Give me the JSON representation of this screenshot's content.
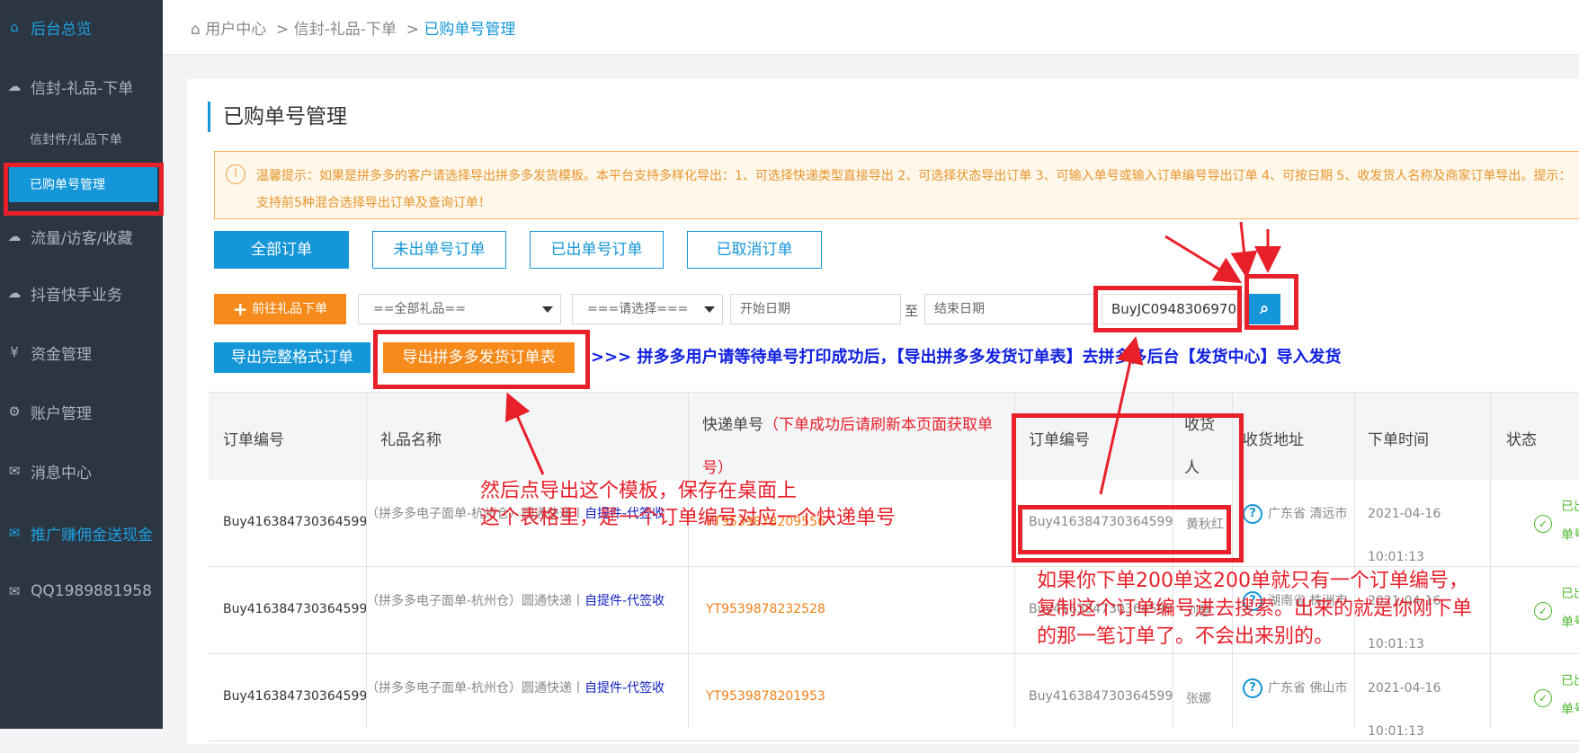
{
  "sidebar": {
    "items": [
      {
        "icon": "home-icon",
        "glyph": "⌂",
        "label": "后台总览"
      },
      {
        "icon": "cloud-icon",
        "glyph": "☁",
        "label": "信封-礼品-下单"
      },
      {
        "icon": "cloud-icon",
        "glyph": "☁",
        "label": "流量/访客/收藏"
      },
      {
        "icon": "cloud-icon",
        "glyph": "☁",
        "label": "抖音快手业务"
      },
      {
        "icon": "yen-icon",
        "glyph": "¥",
        "label": "资金管理"
      },
      {
        "icon": "gears-icon",
        "glyph": "⚙",
        "label": "账户管理"
      },
      {
        "icon": "envelope-icon",
        "glyph": "✉",
        "label": "消息中心"
      },
      {
        "icon": "envelope-icon",
        "glyph": "✉",
        "label": "推广赚佣金送现金"
      },
      {
        "icon": "envelope-icon",
        "glyph": "✉",
        "label": "QQ1989881958"
      }
    ],
    "subitems": [
      "信封件/礼品下单",
      "已购单号管理"
    ]
  },
  "breadcrumb": {
    "home": "用户中心",
    "sep": ">",
    "level1": "信封-礼品-下单",
    "current": "已购单号管理"
  },
  "page_title": "已购单号管理",
  "notice": {
    "icon": "info-icon",
    "text": "温馨提示：如果是拼多多的客户请选择导出拼多多发货模板。本平台支持多样化导出：1、可选择快递类型直接导出 2、可选择状态导出订单 3、可输入单号或输入订单编号导出订单 4、可按日期 5、收发货人名称及商家订单导出。提示：支持前5种混合选择导出订单及查询订单！"
  },
  "tabs": [
    "全部订单",
    "未出单号订单",
    "已出单号订单",
    "已取消订单"
  ],
  "filters": {
    "gift_button": "前往礼品下单",
    "gift_select": "==全部礼品==",
    "status_select": "===请选择===",
    "start_placeholder": "开始日期",
    "to": "至",
    "end_placeholder": "结束日期",
    "search_value": "BuyJC0948306970"
  },
  "exports": {
    "full": "导出完整格式订单",
    "pdd": "导出拼多多发货订单表",
    "tip": ">>> 拼多多用户请等待单号打印成功后，【导出拼多多发货订单表】去拼多多后台【发货中心】导入发货"
  },
  "table": {
    "headers": {
      "order_no": "订单编号",
      "gift_name": "礼品名称",
      "tracking": "快递单号",
      "tracking_note": "（下单成功后请刷新本页面获取单号）",
      "order_no2": "订单编号",
      "receiver": "收货人",
      "address": "收货地址",
      "time": "下单时间",
      "status": "状态"
    },
    "rows": [
      {
        "order_no": "Buy416384730364599",
        "gift_prefix": "（拼多多电子面单-杭州仓）圆通快递丨",
        "gift_link": "自提件-代签收",
        "tracking": "YT9539878209556",
        "order_no2": "Buy416384730364599",
        "receiver": "黄秋红",
        "address": "广东省 清远市",
        "date": "2021-04-16",
        "time": "10:01:13",
        "status": "已出单号"
      },
      {
        "order_no": "Buy416384730364599",
        "gift_prefix": "（拼多多电子面单-杭州仓）圆通快递丨",
        "gift_link": "自提件-代签收",
        "tracking": "YT9539878232528",
        "order_no2": "Buy416384730364599",
        "receiver": "刘慧",
        "address": "湖南省 株洲市",
        "date": "2021-04-16",
        "time": "10:01:13",
        "status": "已出单号"
      },
      {
        "order_no": "Buy416384730364599",
        "gift_prefix": "（拼多多电子面单-杭州仓）圆通快递丨",
        "gift_link": "自提件-代签收",
        "tracking": "YT9539878201953",
        "order_no2": "Buy416384730364599",
        "receiver": "张娜",
        "address": "广东省 佛山市",
        "date": "2021-04-16",
        "time": "10:01:13",
        "status": "已出单号"
      }
    ]
  },
  "annotations": {
    "export_note_line1": "然后点导出这个模板，保存在桌面上",
    "export_note_line2": "这个表格里，是一个订单编号对应一个快递单号",
    "search_note_line1": "如果你下单200单这200单就只有一个订单编号，",
    "search_note_line2": "复制这个订单编号进去搜索。出来的就是你刚下单",
    "search_note_line3": "的那一笔订单了。不会出来别的。"
  },
  "colors": {
    "sidebar_bg": "#2b3642",
    "accent": "#1496d8",
    "orange": "#f68a1a",
    "annotation_red": "#e8202a",
    "tip_blue": "#1020e0"
  }
}
